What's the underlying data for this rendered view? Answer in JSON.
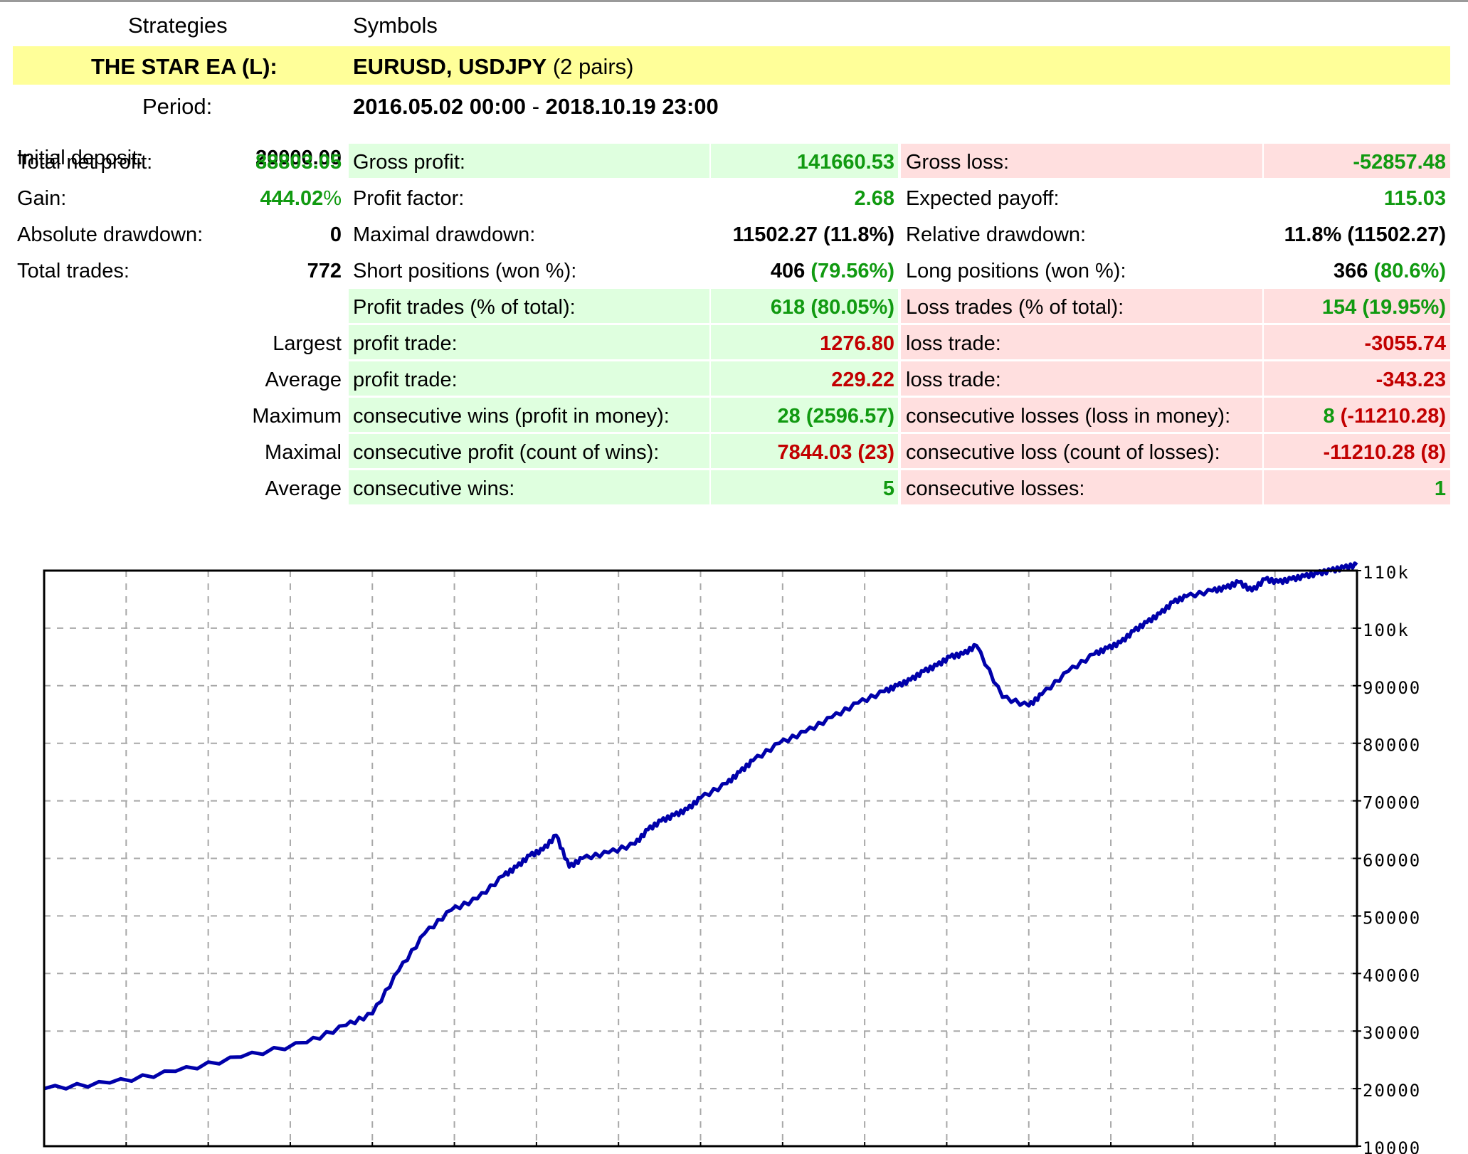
{
  "header": {
    "strategies_label": "Strategies",
    "symbols_label": "Symbols",
    "strategy_name": "THE STAR EA (L):",
    "symbols_bold": "EURUSD, USDJPY",
    "symbols_count": "(2 pairs)",
    "period_label": "Period:",
    "period_start": "2016.05.02 00:00",
    "period_sep": "-",
    "period_end": "2018.10.19 23:00"
  },
  "left_stats": [
    {
      "label": "Initial deposit:",
      "value": "20000.00"
    },
    {
      "label": "Total net profit:",
      "value": "88803.05"
    },
    {
      "label": "Gain:",
      "value": "444.02",
      "suffix": "%"
    },
    {
      "label": "Absolute drawdown:",
      "value": "0"
    },
    {
      "label": "Total trades:",
      "value": "772"
    }
  ],
  "row_prefixes": [
    "Largest",
    "Average",
    "Maximum",
    "Maximal",
    "Average"
  ],
  "mid_stats": [
    {
      "label": "Gross profit:",
      "v1": "141660.53",
      "v2": ""
    },
    {
      "label": "Profit factor:",
      "v1": "2.68",
      "v2": ""
    },
    {
      "label": "Maximal drawdown:",
      "v1": "11502.27 (11.8%)",
      "v2": ""
    },
    {
      "label": "Short positions (won %):",
      "v1": "406",
      "v2": "(79.56%)"
    },
    {
      "label": "Profit trades (% of total):",
      "v1": "618",
      "v2": "(80.05%)"
    },
    {
      "label": "profit trade:",
      "v1": "1276.80",
      "v2": ""
    },
    {
      "label": "profit trade:",
      "v1": "229.22",
      "v2": ""
    },
    {
      "label": "consecutive wins (profit in money):",
      "v1": "28",
      "v2": "(2596.57)"
    },
    {
      "label": "consecutive profit (count of wins):",
      "v1": "7844.03",
      "v2": "(23)"
    },
    {
      "label": "consecutive wins:",
      "v1": "5",
      "v2": ""
    }
  ],
  "right_stats": [
    {
      "label": "Gross loss:",
      "v1": "-52857.48",
      "v2": ""
    },
    {
      "label": "Expected payoff:",
      "v1": "115.03",
      "v2": ""
    },
    {
      "label": "Relative drawdown:",
      "v1": "11.8% (11502.27)",
      "v2": ""
    },
    {
      "label": "Long positions (won %):",
      "v1": "366",
      "v2": "(80.6%)"
    },
    {
      "label": "Loss trades (% of total):",
      "v1": "154",
      "v2": "(19.95%)"
    },
    {
      "label": "loss trade:",
      "v1": "-3055.74",
      "v2": ""
    },
    {
      "label": "loss trade:",
      "v1": "-343.23",
      "v2": ""
    },
    {
      "label": "consecutive losses (loss in money):",
      "v1": "8",
      "v2": "(-11210.28)"
    },
    {
      "label": "consecutive loss (count of losses):",
      "v1": "-11210.28",
      "v2": "(8)"
    },
    {
      "label": "consecutive losses:",
      "v1": "1",
      "v2": ""
    }
  ],
  "colors": {
    "highlight_yellow": "#ffff99",
    "profit_green_bg": "#dfffdf",
    "loss_red_bg": "#ffdfdf",
    "green_text": "#119a11",
    "red_text": "#c20000",
    "curve_blue": "#0000aa"
  },
  "chart_data": {
    "type": "line",
    "title": "",
    "xlabel": "",
    "ylabel": "",
    "ylim": [
      10000,
      110000
    ],
    "yticks": [
      "110k",
      "100k",
      "90000",
      "80000",
      "70000",
      "60000",
      "50000",
      "40000",
      "30000",
      "20000",
      "10000"
    ],
    "grid": true,
    "x_gridlines": 15,
    "series": [
      {
        "color": "#0000aa",
        "x": [
          0,
          5,
          10,
          15,
          20,
          23,
          25,
          27,
          29,
          31,
          33,
          35,
          36,
          37,
          38,
          39,
          40,
          41,
          43,
          45,
          46,
          47,
          48,
          49,
          50,
          52,
          53,
          54,
          56,
          58,
          60,
          62,
          64,
          65,
          66,
          67,
          68,
          69,
          70,
          71,
          73,
          75,
          76,
          78,
          80,
          81,
          82,
          83,
          84,
          85,
          86,
          87,
          89,
          90,
          91,
          92,
          93,
          94,
          95,
          96,
          97,
          98,
          99,
          100
        ],
        "values": [
          20000,
          21000,
          23000,
          25500,
          28000,
          31000,
          33000,
          40500,
          47000,
          51000,
          53000,
          57000,
          58500,
          60500,
          61500,
          64000,
          58500,
          60000,
          61000,
          62500,
          65000,
          66500,
          67500,
          68500,
          70500,
          73000,
          75000,
          77000,
          80000,
          82000,
          84500,
          87000,
          89000,
          90000,
          91000,
          92500,
          93500,
          95000,
          95500,
          97000,
          88000,
          86500,
          88500,
          92500,
          95500,
          96500,
          97500,
          99500,
          101000,
          102500,
          104500,
          105500,
          106500,
          107000,
          108000,
          106500,
          108500,
          108000,
          108500,
          109000,
          109500,
          110000,
          110500,
          111000
        ]
      }
    ]
  }
}
